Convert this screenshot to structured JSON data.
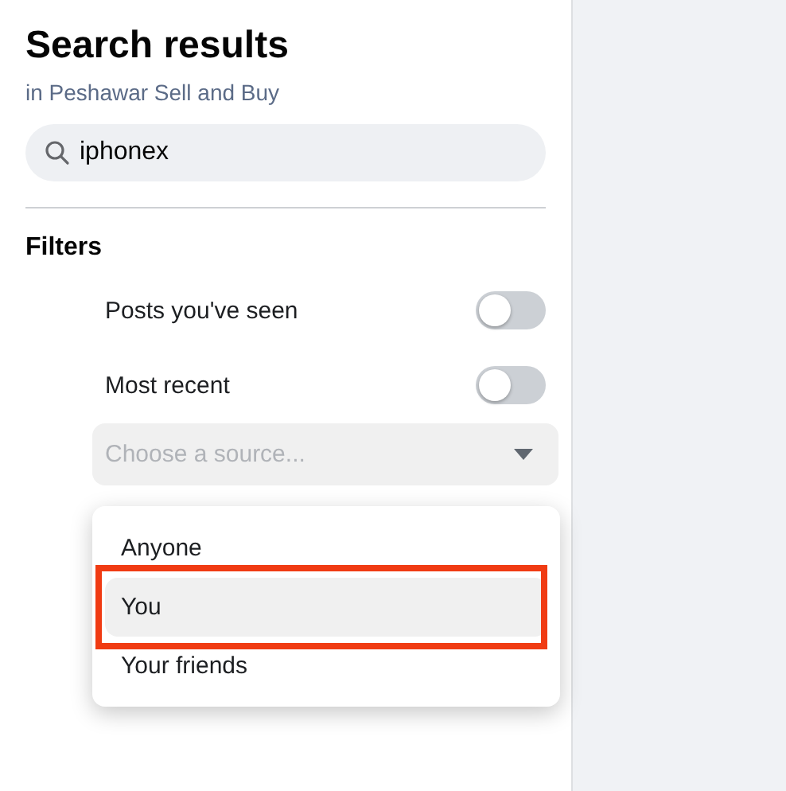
{
  "header": {
    "title": "Search results",
    "subtitle": "in Peshawar Sell and Buy"
  },
  "search": {
    "value": "iphonex"
  },
  "filters": {
    "heading": "Filters",
    "toggles": [
      {
        "label": "Posts you've seen",
        "on": false
      },
      {
        "label": "Most recent",
        "on": false
      }
    ],
    "source": {
      "placeholder": "Choose a source...",
      "options": [
        {
          "label": "Anyone",
          "selected": false,
          "highlighted": false
        },
        {
          "label": "You",
          "selected": true,
          "highlighted": true
        },
        {
          "label": "Your friends",
          "selected": false,
          "highlighted": false
        }
      ]
    }
  }
}
